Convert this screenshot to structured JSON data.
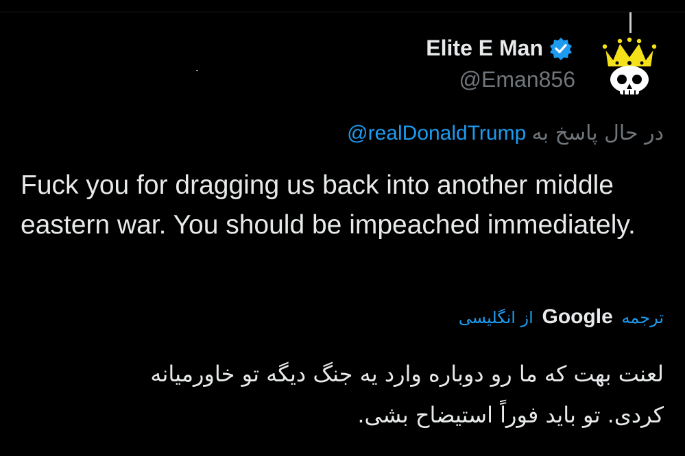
{
  "author": {
    "display_name": "Elite E Man",
    "handle": "@Eman856",
    "avatar_icon": "crowned-skull-icon",
    "verified_icon": "verified-badge-icon",
    "verified_color": "#1d9bf0"
  },
  "reply": {
    "prefix": "در حال پاسخ به",
    "mention": "@realDonaldTrump"
  },
  "tweet": {
    "text": "Fuck you for dragging us back into another middle eastern war. You should be impeached immediately."
  },
  "translation": {
    "translate_label": "ترجمه",
    "provider": "Google",
    "source_language": "از انگلیسی",
    "text": "لعنت بهت که ما رو دوباره وارد یه جنگ دیگه تو خاورمیانه کردی. تو باید فوراً استیضاح بشی."
  },
  "colors": {
    "background": "#000000",
    "text": "#e7e9ea",
    "secondary_text": "#71767b",
    "accent": "#1d9bf0",
    "crown": "#f5e11a"
  }
}
